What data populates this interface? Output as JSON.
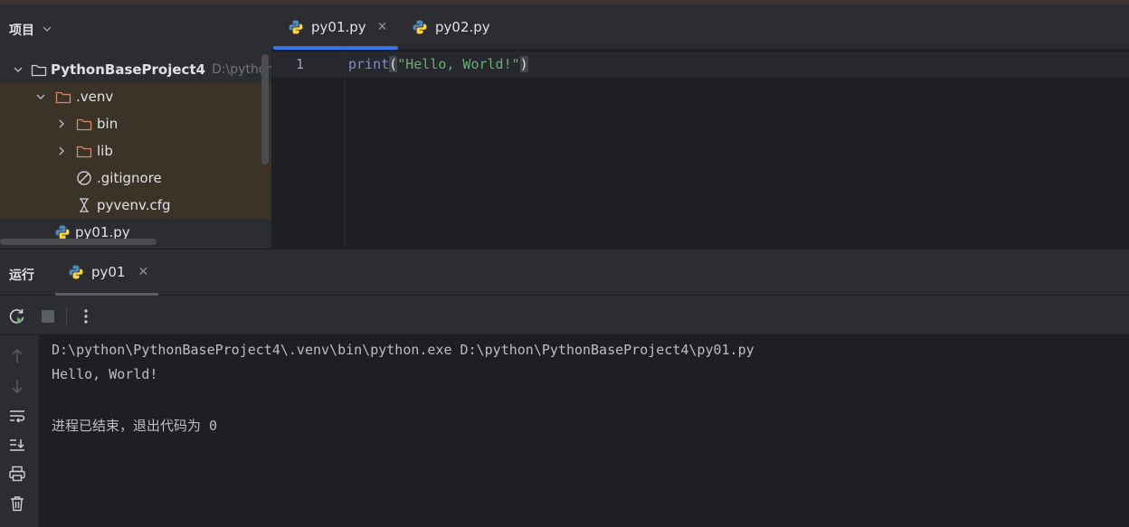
{
  "project_panel": {
    "title": "项目",
    "tree": [
      {
        "label": "PythonBaseProject4",
        "path": "D:\\python\\",
        "icon": "folder-icon"
      },
      {
        "label": ".venv",
        "icon": "folder-icon"
      },
      {
        "label": "bin",
        "icon": "folder-icon"
      },
      {
        "label": "lib",
        "icon": "folder-icon"
      },
      {
        "label": ".gitignore",
        "icon": "ignore-file-icon"
      },
      {
        "label": "pyvenv.cfg",
        "icon": "config-file-icon"
      },
      {
        "label": "py01.py",
        "icon": "python-file-icon"
      }
    ]
  },
  "editor": {
    "tabs": [
      {
        "label": "py01.py",
        "active": true,
        "close": "✕"
      },
      {
        "label": "py02.py",
        "active": false
      }
    ],
    "line_number": "1",
    "code": {
      "func": "print",
      "open": "(",
      "string": "\"Hello, World!\"",
      "close": ")"
    }
  },
  "run_panel": {
    "title": "运行",
    "tab_label": "py01",
    "tab_close": "✕",
    "output": [
      "D:\\python\\PythonBaseProject4\\.venv\\bin\\python.exe D:\\python\\PythonBaseProject4\\py01.py",
      "Hello, World!",
      "进程已结束，退出代码为 0"
    ]
  },
  "colors": {
    "accent": "#3574f0",
    "folder": "#d08b6b",
    "string": "#6aab73",
    "keyword": "#8888c6",
    "venv_highlight": "#3b3327",
    "rerun": "#5fb865"
  }
}
